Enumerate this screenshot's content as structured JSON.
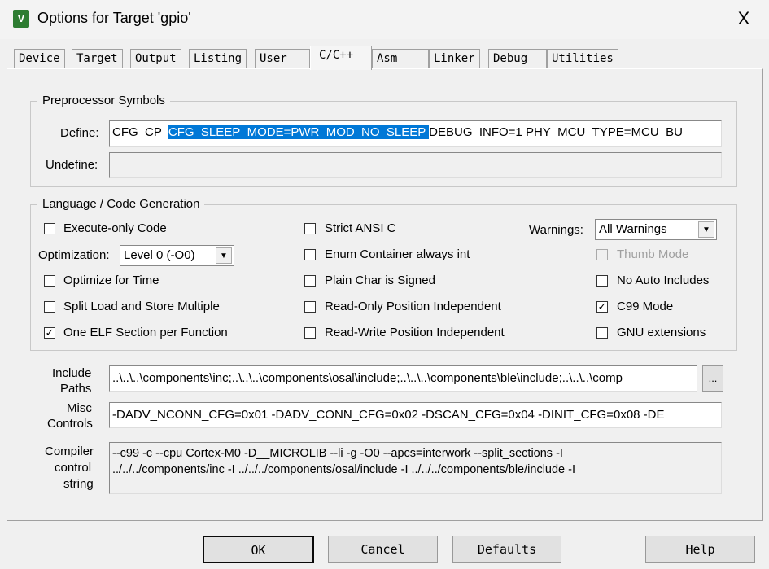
{
  "window": {
    "title": "Options for Target 'gpio'",
    "close": "X",
    "icon": "keil-uvision-icon"
  },
  "tabs": [
    {
      "label": "Device"
    },
    {
      "label": "Target"
    },
    {
      "label": "Output"
    },
    {
      "label": "Listing"
    },
    {
      "label": "User"
    },
    {
      "label": "C/C++",
      "active": true
    },
    {
      "label": "Asm"
    },
    {
      "label": "Linker"
    },
    {
      "label": "Debug"
    },
    {
      "label": "Utilities"
    }
  ],
  "preprocessor": {
    "title": "Preprocessor Symbols",
    "define_label": "Define:",
    "define_pre": "CFG_CP  ",
    "define_selected": "CFG_SLEEP_MODE=PWR_MOD_NO_SLEEP ",
    "define_post": "DEBUG_INFO=1 PHY_MCU_TYPE=MCU_BU",
    "undefine_label": "Undefine:",
    "undefine_value": ""
  },
  "language": {
    "title": "Language / Code Generation",
    "execute_only": {
      "label": "Execute-only Code",
      "checked": false
    },
    "optimization_label": "Optimization:",
    "optimization_value": "Level 0 (-O0)",
    "optimize_time": {
      "label": "Optimize for Time",
      "checked": false
    },
    "split_load": {
      "label": "Split Load and Store Multiple",
      "checked": false
    },
    "one_elf": {
      "label": "One ELF Section per Function",
      "checked": true
    },
    "strict_ansi": {
      "label": "Strict ANSI C",
      "checked": false
    },
    "enum_int": {
      "label": "Enum Container always int",
      "checked": false
    },
    "plain_char": {
      "label": "Plain Char is Signed",
      "checked": false
    },
    "ro_pi": {
      "label": "Read-Only Position Independent",
      "checked": false
    },
    "rw_pi": {
      "label": "Read-Write Position Independent",
      "checked": false
    },
    "warnings_label": "Warnings:",
    "warnings_value": "All Warnings",
    "thumb_mode": {
      "label": "Thumb Mode",
      "checked": false,
      "disabled": true
    },
    "no_auto_includes": {
      "label": "No Auto Includes",
      "checked": false
    },
    "c99": {
      "label": "C99 Mode",
      "checked": true
    },
    "gnu_ext": {
      "label": "GNU extensions",
      "checked": false
    }
  },
  "include": {
    "label1": "Include",
    "label2": "Paths",
    "value": "..\\..\\..\\components\\inc;..\\..\\..\\components\\osal\\include;..\\..\\..\\components\\ble\\include;..\\..\\..\\comp",
    "browse": "..."
  },
  "misc": {
    "label1": "Misc",
    "label2": "Controls",
    "value": "-DADV_NCONN_CFG=0x01  -DADV_CONN_CFG=0x02  -DSCAN_CFG=0x04   -DINIT_CFG=0x08  -DE"
  },
  "compiler": {
    "label1": "Compiler",
    "label2": "control",
    "label3": "string",
    "line1": "--c99 -c --cpu Cortex-M0 -D__MICROLIB --li -g -O0 --apcs=interwork --split_sections -I",
    "line2": "../../../components/inc -I ../../../components/osal/include -I ../../../components/ble/include -I"
  },
  "buttons": {
    "ok": "OK",
    "cancel": "Cancel",
    "defaults": "Defaults",
    "help": "Help"
  }
}
